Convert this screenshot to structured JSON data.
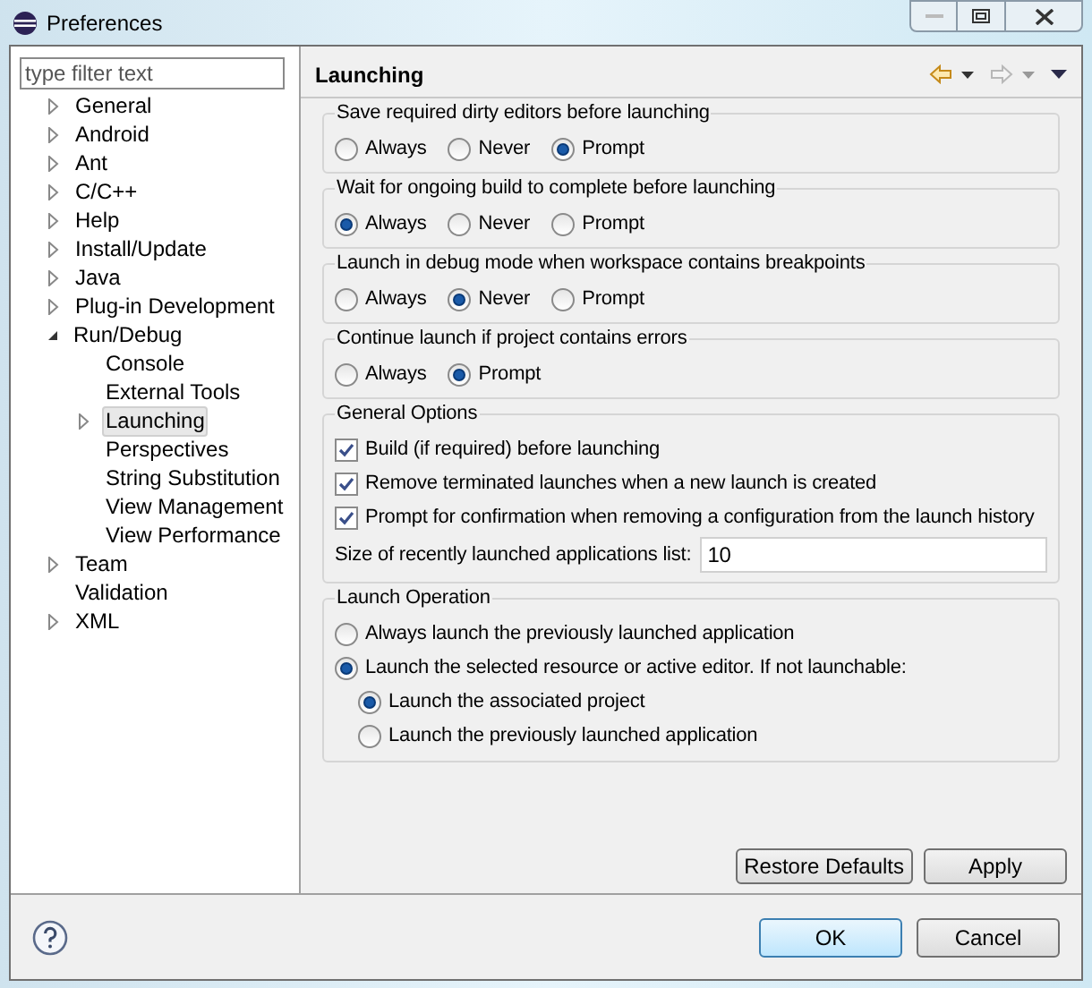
{
  "window": {
    "title": "Preferences"
  },
  "filter": {
    "placeholder": "type filter text"
  },
  "tree": [
    {
      "label": "General",
      "expanded": false,
      "selected": false
    },
    {
      "label": "Android",
      "expanded": false,
      "selected": false
    },
    {
      "label": "Ant",
      "expanded": false,
      "selected": false
    },
    {
      "label": "C/C++",
      "expanded": false,
      "selected": false
    },
    {
      "label": "Help",
      "expanded": false,
      "selected": false
    },
    {
      "label": "Install/Update",
      "expanded": false,
      "selected": false
    },
    {
      "label": "Java",
      "expanded": false,
      "selected": false
    },
    {
      "label": "Plug-in Development",
      "expanded": false,
      "selected": false
    },
    {
      "label": "Run/Debug",
      "expanded": true,
      "selected": false,
      "children": [
        {
          "label": "Console",
          "selected": false
        },
        {
          "label": "External Tools",
          "selected": false
        },
        {
          "label": "Launching",
          "expanded": false,
          "selected": true
        },
        {
          "label": "Perspectives",
          "selected": false
        },
        {
          "label": "String Substitution",
          "selected": false
        },
        {
          "label": "View Management",
          "selected": false
        },
        {
          "label": "View Performance",
          "selected": false
        }
      ]
    },
    {
      "label": "Team",
      "expanded": false,
      "selected": false
    },
    {
      "label": "Validation",
      "selected": false
    },
    {
      "label": "XML",
      "expanded": false,
      "selected": false
    }
  ],
  "page": {
    "title": "Launching"
  },
  "radio_groups": [
    {
      "title": "Save required dirty editors before launching",
      "options": [
        {
          "label": "Always",
          "selected": false
        },
        {
          "label": "Never",
          "selected": false
        },
        {
          "label": "Prompt",
          "selected": true
        }
      ]
    },
    {
      "title": "Wait for ongoing build to complete before launching",
      "options": [
        {
          "label": "Always",
          "selected": true
        },
        {
          "label": "Never",
          "selected": false
        },
        {
          "label": "Prompt",
          "selected": false
        }
      ]
    },
    {
      "title": "Launch in debug mode when workspace contains breakpoints",
      "options": [
        {
          "label": "Always",
          "selected": false
        },
        {
          "label": "Never",
          "selected": true
        },
        {
          "label": "Prompt",
          "selected": false
        }
      ]
    },
    {
      "title": "Continue launch if project contains errors",
      "options": [
        {
          "label": "Always",
          "selected": false
        },
        {
          "label": "Prompt",
          "selected": true
        }
      ]
    }
  ],
  "general_options": {
    "title": "General Options",
    "checkboxes": [
      {
        "label": "Build (if required) before launching",
        "checked": true
      },
      {
        "label": "Remove terminated launches when a new launch is created",
        "checked": true
      },
      {
        "label": "Prompt for confirmation when removing a configuration from the launch history",
        "checked": true
      }
    ],
    "history_size": {
      "label": "Size of recently launched applications list:",
      "value": "10"
    }
  },
  "launch_operation": {
    "title": "Launch Operation",
    "options": [
      {
        "label": "Always launch the previously launched application",
        "selected": false
      },
      {
        "label": "Launch the selected resource or active editor. If not launchable:",
        "selected": true,
        "children": [
          {
            "label": "Launch the associated project",
            "selected": true
          },
          {
            "label": "Launch the previously launched application",
            "selected": false
          }
        ]
      }
    ]
  },
  "page_buttons": [
    "Restore Defaults",
    "Apply"
  ],
  "dialog_buttons": [
    {
      "label": "OK",
      "kind": "default"
    },
    {
      "label": "Cancel",
      "kind": "normal"
    }
  ]
}
